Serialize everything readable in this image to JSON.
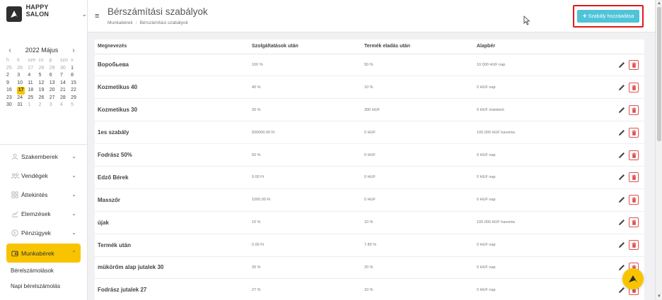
{
  "brand": {
    "name": "HAPPY SALON",
    "logo_icon": "salon-logo-icon",
    "caret": "⌄"
  },
  "calendar": {
    "month_label": "2022 Május",
    "prev": "‹",
    "next": "›",
    "weekdays": [
      "h",
      "k",
      "sze",
      "cs",
      "p",
      "szo",
      "v"
    ],
    "weeks": [
      [
        "25",
        "26",
        "27",
        "28",
        "29",
        "30",
        "1"
      ],
      [
        "2",
        "3",
        "4",
        "5",
        "6",
        "7",
        "8"
      ],
      [
        "9",
        "10",
        "11",
        "12",
        "13",
        "14",
        "15"
      ],
      [
        "16",
        "17",
        "18",
        "19",
        "20",
        "21",
        "22"
      ],
      [
        "23",
        "24",
        "25",
        "26",
        "27",
        "28",
        "29"
      ],
      [
        "30",
        "31",
        "1",
        "2",
        "3",
        "4",
        "5"
      ]
    ],
    "selected_day": "17",
    "accent": "#f8c400"
  },
  "sidebar": {
    "items": [
      {
        "label": "Szakemberek",
        "icon": "person-icon",
        "caret": "⌄"
      },
      {
        "label": "Vendégek",
        "icon": "group-icon",
        "caret": "⌄"
      },
      {
        "label": "Áttekintés",
        "icon": "grid-icon",
        "caret": "⌄"
      },
      {
        "label": "Elemzések",
        "icon": "chart-icon",
        "caret": "⌄"
      },
      {
        "label": "Pénzügyek",
        "icon": "coin-icon",
        "caret": "⌄"
      },
      {
        "label": "Munkabérek",
        "icon": "wallet-icon",
        "caret": "⌃"
      }
    ],
    "subitems": [
      {
        "label": "Bérelszámolások"
      },
      {
        "label": "Napi bérelszámolás"
      }
    ]
  },
  "header": {
    "menu_icon": "≡",
    "title": "Bérszámítási szabályok",
    "breadcrumb": [
      "Munkabérek",
      "Bérszámítási szabályok"
    ],
    "breadcrumb_sep": "/",
    "add_button": {
      "plus": "+",
      "label": "Szabály hozzáadása",
      "color": "#4fc3d8",
      "highlight": "#e01818"
    }
  },
  "table": {
    "columns": [
      "Megnevezés",
      "Szolgáltatások után",
      "Termék eladás után",
      "Alapbér",
      ""
    ],
    "rows": [
      {
        "name": "Воробьева",
        "services": "100 %",
        "products": "50 %",
        "base": "10.000 HUF nap"
      },
      {
        "name": "Kozmetikus 40",
        "services": "40 %",
        "products": "10 %",
        "base": "0 HUF nap"
      },
      {
        "name": "Kozmetikus 30",
        "services": "30 %",
        "products": "300 HUF",
        "base": "0 HUF óránként"
      },
      {
        "name": "1es szabály",
        "services": "500000.00 Ft",
        "products": "0 HUF",
        "base": "100.000 HUF havonta"
      },
      {
        "name": "Fodrász 50%",
        "services": "50 %",
        "products": "0 HUF",
        "base": "0 HUF nap"
      },
      {
        "name": "Edző Bérek",
        "services": "0.00 Ft",
        "products": "0 HUF",
        "base": "0 HUF nap"
      },
      {
        "name": "Masszőr",
        "services": "1000.00 Ft",
        "products": "0 HUF",
        "base": "0 HUF nap"
      },
      {
        "name": "újak",
        "services": "10 %",
        "products": "10 %",
        "base": "100.000 HUF havonta"
      },
      {
        "name": "Termék után",
        "services": "0.00 Ft",
        "products": "7.80 %",
        "base": "0 HUF nap"
      },
      {
        "name": "mükörőm alap jutalek 30",
        "services": "30 %",
        "products": "20 %",
        "base": "0 HUF nap"
      },
      {
        "name": "Fodrász jutalek 27",
        "services": "27 %",
        "products": "10 %",
        "base": "0 HUF nap"
      }
    ],
    "row_actions": {
      "edit_icon": "pencil-icon",
      "delete_icon": "trash-icon",
      "delete_color": "#e05050"
    }
  },
  "scrollbar": {
    "up": "▲",
    "down": "▼"
  },
  "fab": {
    "icon": "salon-logo-icon",
    "color": "#f8c400"
  }
}
